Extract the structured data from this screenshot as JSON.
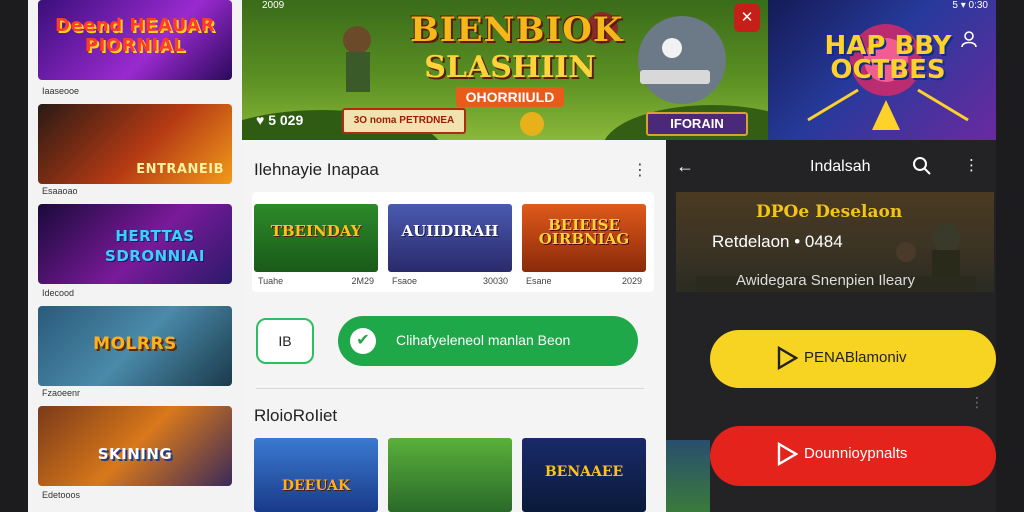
{
  "sidebar": {
    "cards": [
      {
        "title": "Deend HEAUAR PIORNIAL",
        "label": "Iaaseooe"
      },
      {
        "title": "ENTRANEIB",
        "label": "Esaaoao"
      },
      {
        "title": "HERTTAS SDRONNIAI",
        "label": "Idecood"
      },
      {
        "title": "MOLRRS",
        "label": "Fzaoeenr"
      },
      {
        "title": "SKINING",
        "label": "Edetooos"
      }
    ],
    "card_colors": [
      "#6a2aa0",
      "#a83a1a",
      "#3a1a6a",
      "#2a6a9a",
      "#c56a1a"
    ]
  },
  "banner": {
    "top_number": "2009",
    "logo_main": "BIENBIOK",
    "logo_sub": "SLASHIIN",
    "logo_tag": "OHORRIIULD",
    "likes": "5 029",
    "promo_label": "3O noma PETRDNEA",
    "inform_label": "IFORAIN",
    "close_label": "✕"
  },
  "promo_right": {
    "status": "5 ▾ 0:30",
    "title": "HAP BBY OCTBES"
  },
  "center": {
    "header": "Ilehnayie Inapaa",
    "tiles": [
      {
        "title": "TBEINDAY",
        "left": "Tuahe",
        "right": "2M29",
        "color": "#2d7d2a"
      },
      {
        "title": "AUIIDIRAH",
        "left": "Fsaoe",
        "right": "30030",
        "color": "#3a4aa0"
      },
      {
        "title": "BEIEISE OIRBNIAG",
        "left": "Esane",
        "right": "2029",
        "color": "#c8461a"
      }
    ],
    "chip_number": "IB",
    "cta_label": "Clihafyeleneol manlan Beon",
    "cta_icon": "✔",
    "section_title": "RloioRoIiet",
    "bottom_tiles": [
      {
        "title": "DEEUAK",
        "color": "#2a6ad0"
      },
      {
        "title": "",
        "color": "#3a8a3a"
      },
      {
        "title": "BENAAEE",
        "color": "#1a2a6a"
      }
    ]
  },
  "right": {
    "title": "Indalsah",
    "hero_title": "DPOe Deselaon",
    "hero_line": "Retdelaon • 0484",
    "description": "Awidegara Snenpien Ileary",
    "yellow_btn": "PENABlamoniv",
    "red_btn": "Dounnioypnalts"
  }
}
